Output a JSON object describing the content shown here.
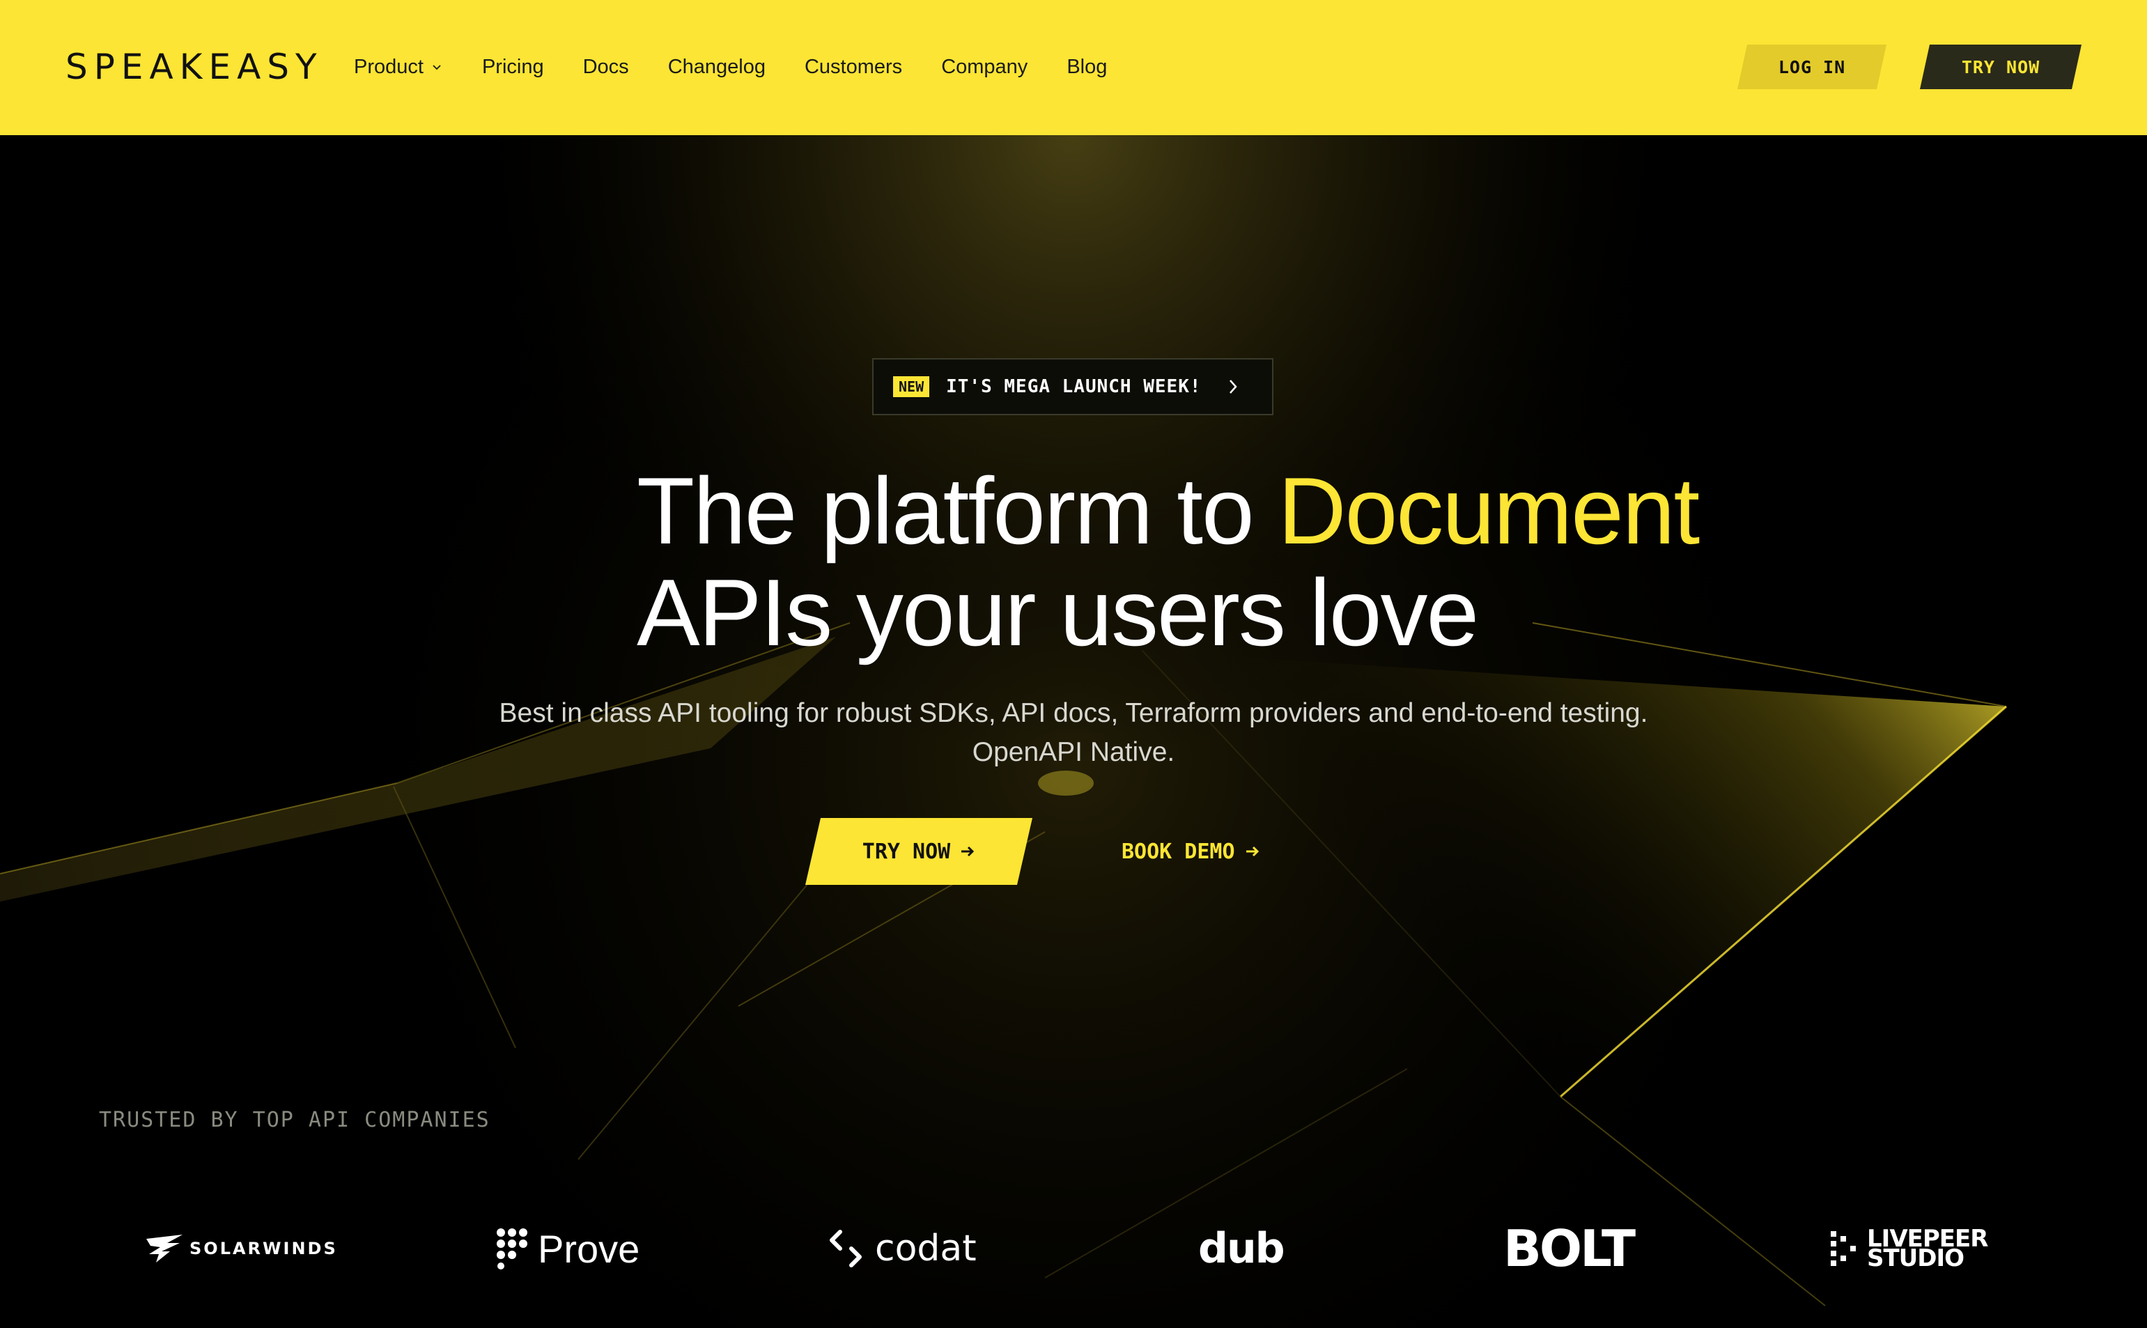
{
  "header": {
    "logo": "SPEAKEASY",
    "nav": [
      {
        "label": "Product",
        "has_dropdown": true
      },
      {
        "label": "Pricing"
      },
      {
        "label": "Docs"
      },
      {
        "label": "Changelog"
      },
      {
        "label": "Customers"
      },
      {
        "label": "Company"
      },
      {
        "label": "Blog"
      }
    ],
    "login_label": "LOG IN",
    "try_now_label": "TRY NOW"
  },
  "announcement": {
    "tag": "NEW",
    "text": "IT'S MEGA LAUNCH WEEK!"
  },
  "hero": {
    "headline_part1": "The platform to ",
    "headline_accent": "Document",
    "headline_line2": "APIs your users love",
    "subhead_line1": "Best in class API tooling for robust SDKs, API docs, Terraform providers and end-to-end testing.",
    "subhead_line2": "OpenAPI Native.",
    "cta_primary": "TRY NOW",
    "cta_secondary": "BOOK DEMO"
  },
  "trusted": {
    "label": "TRUSTED BY TOP API COMPANIES",
    "logos": [
      "SOLARWINDS",
      "Prove",
      "codat",
      "dub",
      "BOLT",
      "LIVEPEER",
      "STUDIO"
    ]
  },
  "colors": {
    "accent": "#FCE534",
    "header_bg": "#FCE534",
    "background": "#000000",
    "login_bg": "#E3CB2B",
    "dark_button_bg": "#2a2a1a"
  }
}
